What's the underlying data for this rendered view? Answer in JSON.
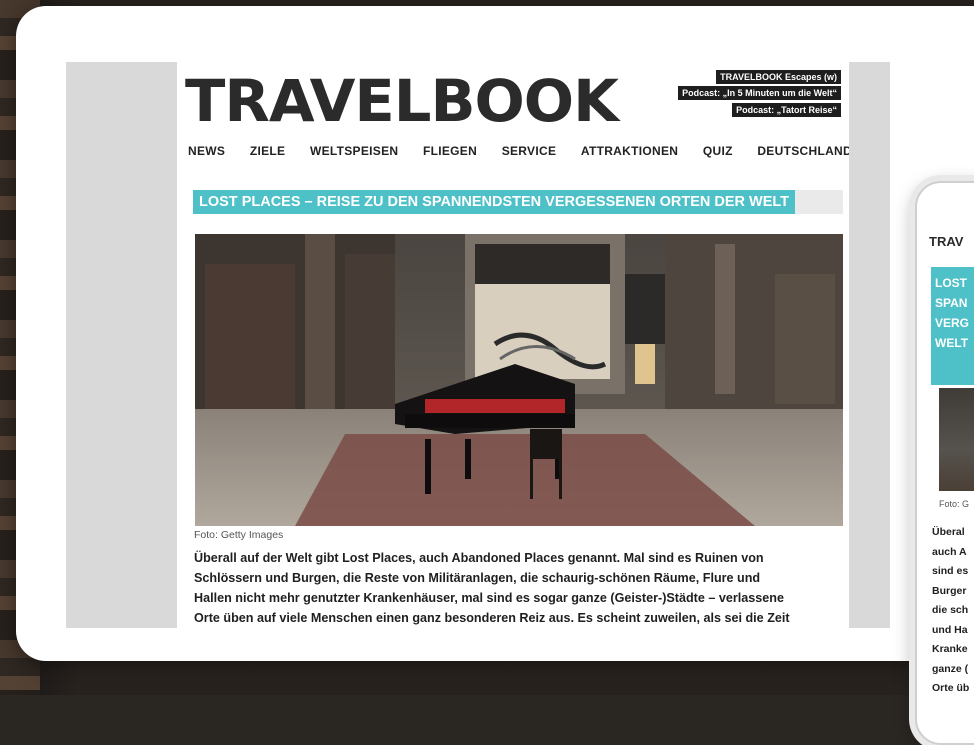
{
  "site": {
    "logo": "TRAVELBOOK",
    "promos": [
      "TRAVELBOOK Escapes (w)",
      "Podcast: „In 5 Minuten um die Welt“",
      "Podcast: „Tatort Reise“"
    ],
    "nav": [
      "NEWS",
      "ZIELE",
      "WELTSPEISEN",
      "FLIEGEN",
      "SERVICE",
      "ATTRAKTIONEN",
      "QUIZ",
      "DEUTSCHLAND"
    ]
  },
  "article": {
    "headline": "LOST PLACES – REISE ZU DEN SPANNENDSTEN VERGESSENEN ORTEN DER WELT",
    "caption": "Foto: Getty Images",
    "body_lines": [
      "Überall auf der Welt gibt Lost Places, auch Abandoned Places genannt. Mal sind es Ruinen von",
      "Schlössern und Burgen, die Reste von Militäranlagen, die schaurig-schönen Räume, Flure und",
      "Hallen nicht mehr genutzter Krankenhäuser, mal sind es sogar ganze (Geister-)Städte – verlassene",
      "Orte üben auf viele Menschen einen ganz besonderen Reiz aus. Es scheint zuweilen, als sei die Zeit"
    ]
  },
  "mobile": {
    "logo": "TRAV",
    "headline_lines": [
      "LOST",
      "SPAN",
      "VERG",
      "WELT"
    ],
    "caption": "Foto: G",
    "body_lines": [
      "Überal",
      "auch A",
      "sind es",
      "Burger",
      "die sch",
      "und Ha",
      "Kranke",
      "ganze (",
      "Orte üb"
    ]
  },
  "colors": {
    "accent": "#4ec0c7",
    "promo_bg": "#1e1e1e",
    "text": "#1f1f1f"
  }
}
